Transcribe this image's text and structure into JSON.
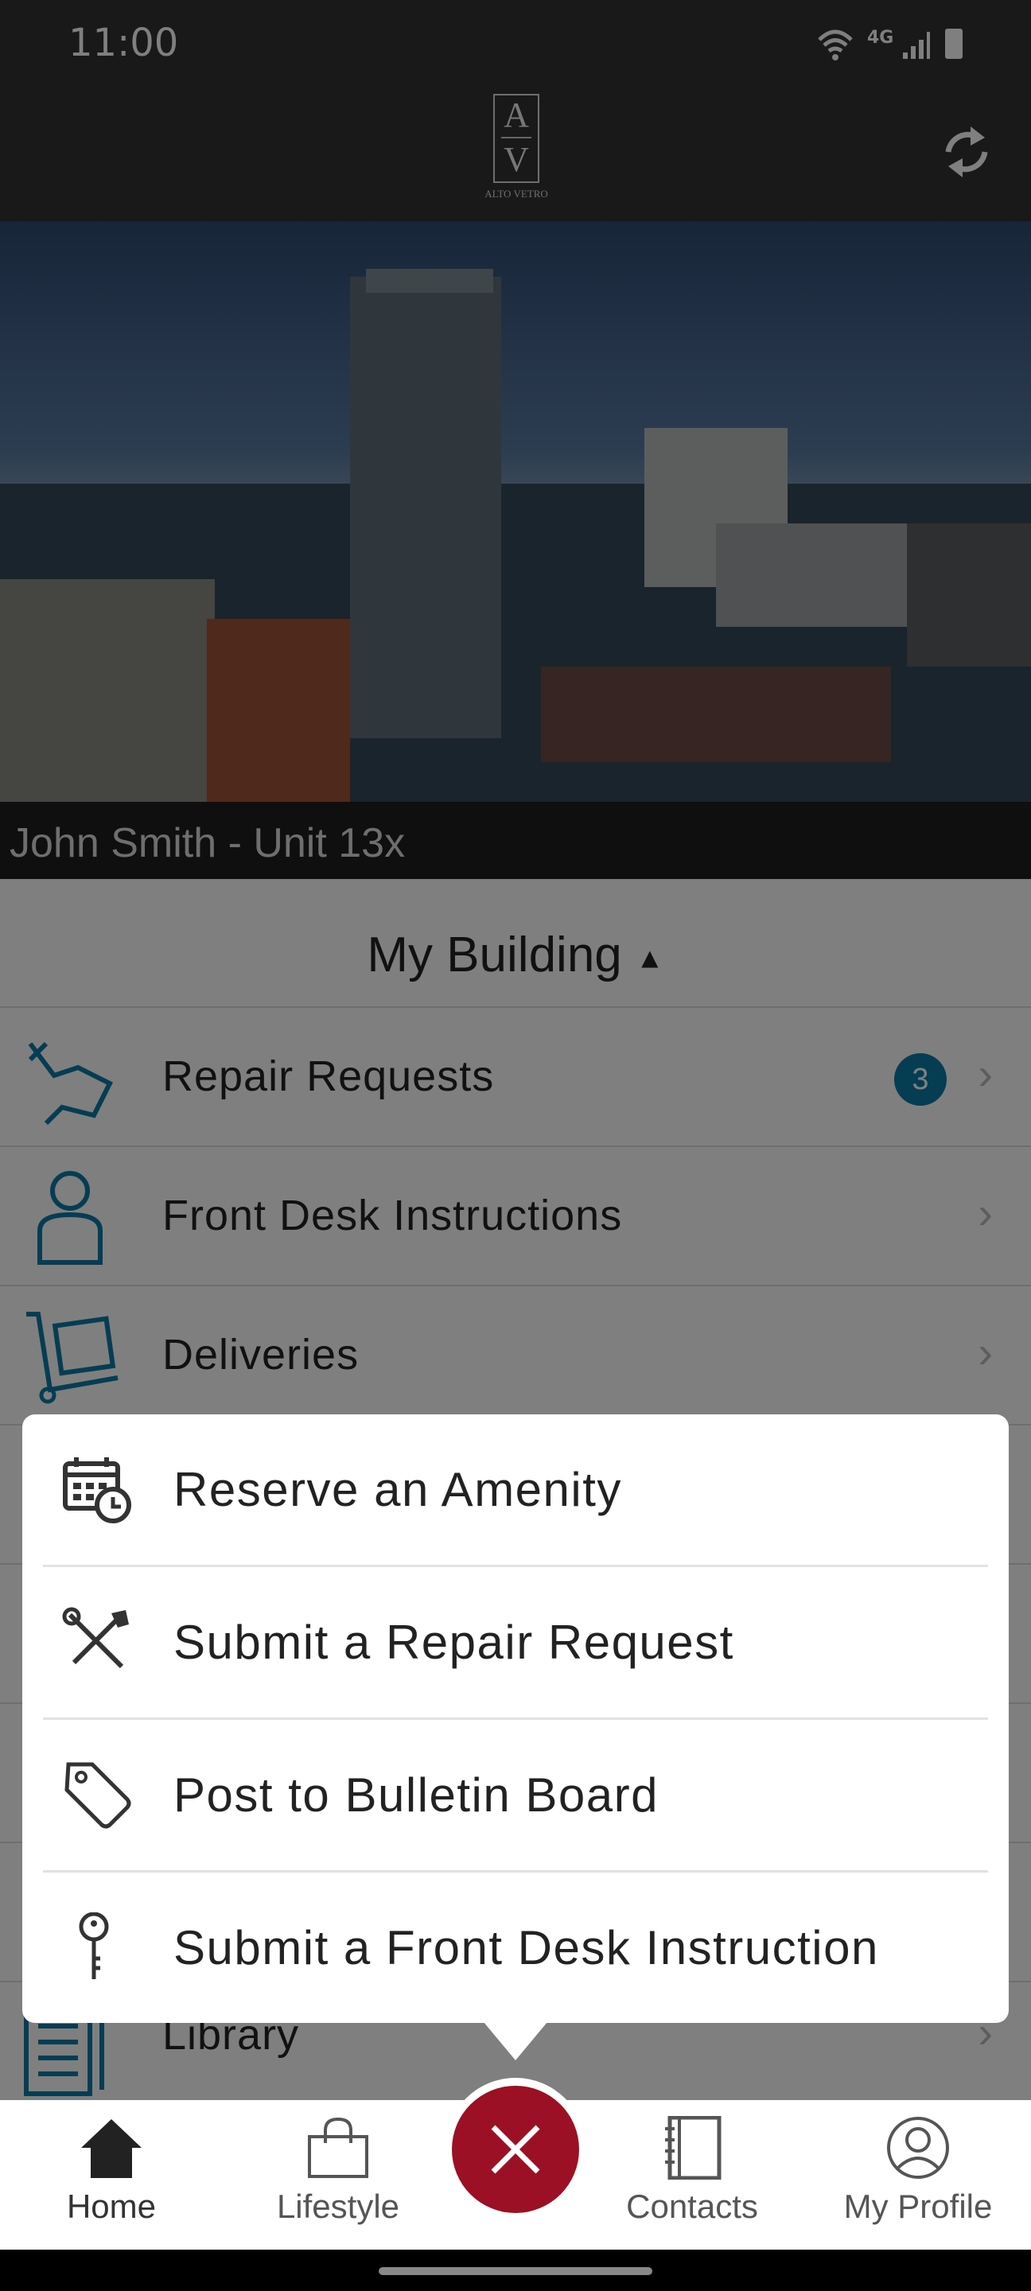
{
  "status_bar": {
    "time": "11:00",
    "network": "4G"
  },
  "header": {
    "logo_letters": [
      "A",
      "V"
    ],
    "logo_text": "ALTO VETRO",
    "refresh_icon": "refresh-icon"
  },
  "hero": {
    "resident": "John Smith - Unit 13x"
  },
  "section": {
    "title": "My Building",
    "toggle_icon": "caret-up-icon"
  },
  "rows": [
    {
      "label": "Repair Requests",
      "badge": "3",
      "icon": "repair-hand-icon"
    },
    {
      "label": "Front Desk Instructions",
      "icon": "person-icon"
    },
    {
      "label": "Deliveries",
      "icon": "hand-truck-icon"
    },
    {
      "label": "Library",
      "icon": "library-icon"
    }
  ],
  "popup": {
    "items": [
      {
        "label": "Reserve an Amenity",
        "icon": "calendar-clock-icon"
      },
      {
        "label": "Submit a Repair Request",
        "icon": "tools-icon"
      },
      {
        "label": "Post to Bulletin Board",
        "icon": "tag-icon"
      },
      {
        "label": "Submit a Front Desk Instruction",
        "icon": "key-icon"
      }
    ]
  },
  "nav": {
    "items": [
      {
        "label": "Home",
        "icon": "home-icon"
      },
      {
        "label": "Lifestyle",
        "icon": "shopping-bag-icon"
      },
      {
        "label": "Contacts",
        "icon": "address-book-icon"
      },
      {
        "label": "My Profile",
        "icon": "profile-icon"
      }
    ],
    "fab_icon": "close-icon"
  },
  "colors": {
    "accent": "#0b7aa6",
    "fab": "#9b1024",
    "header": "#333333"
  }
}
